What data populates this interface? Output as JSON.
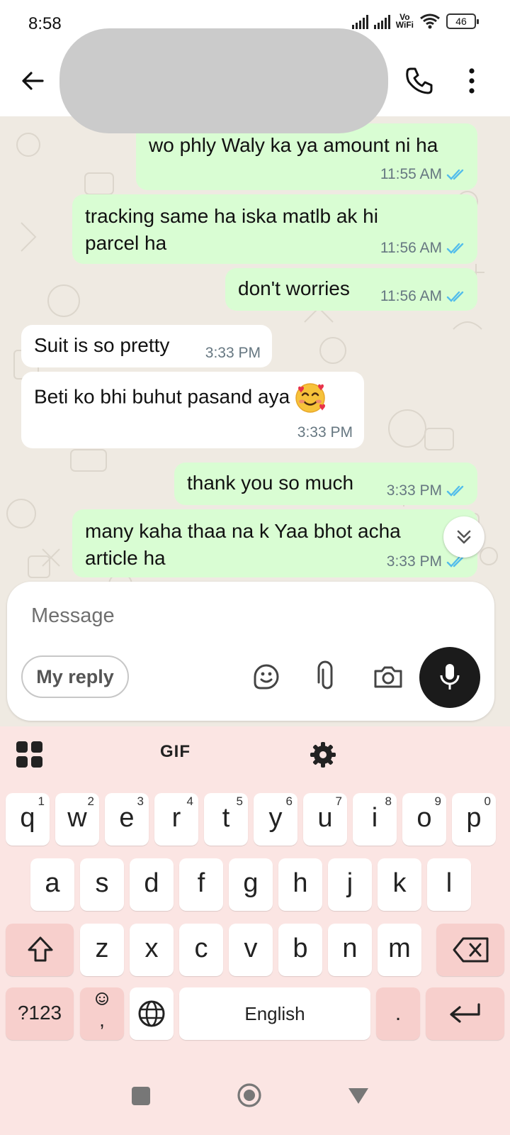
{
  "status_bar": {
    "time": "8:58",
    "network_label_top": "Vo",
    "network_label_bottom": "WiFi",
    "battery": "46"
  },
  "header": {
    "back_icon": "arrow-left-icon",
    "call_icon": "phone-icon",
    "menu_icon": "more-vertical-icon"
  },
  "messages": [
    {
      "direction": "outgoing",
      "text": "wo phly Waly ka ya amount ni ha",
      "time": "11:55 AM",
      "read": true
    },
    {
      "direction": "outgoing",
      "text": "tracking same ha iska matlb ak hi parcel ha",
      "time": "11:56 AM",
      "read": true
    },
    {
      "direction": "outgoing",
      "text": "don't worries",
      "time": "11:56 AM",
      "read": true
    },
    {
      "direction": "incoming",
      "text": "Suit is so pretty",
      "time": "3:33 PM"
    },
    {
      "direction": "incoming",
      "text": "Beti ko bhi buhut pasand aya",
      "emoji": "smiling-face-with-hearts",
      "time": "3:33 PM"
    },
    {
      "direction": "outgoing",
      "text": "thank you so much",
      "time": "3:33 PM",
      "read": true
    },
    {
      "direction": "outgoing",
      "text": "many kaha thaa na k Yaa bhot acha article ha",
      "time": "3:33 PM",
      "read": true
    }
  ],
  "composer": {
    "placeholder": "Message",
    "reply_chip": "My reply",
    "icons": [
      "sticker-icon",
      "attachment-icon",
      "camera-icon",
      "microphone-icon"
    ]
  },
  "keyboard": {
    "toolbar": {
      "gif_label": "GIF",
      "icons": [
        "apps-grid-icon",
        "settings-gear-icon"
      ]
    },
    "row1": [
      {
        "key": "q",
        "hint": "1"
      },
      {
        "key": "w",
        "hint": "2"
      },
      {
        "key": "e",
        "hint": "3"
      },
      {
        "key": "r",
        "hint": "4"
      },
      {
        "key": "t",
        "hint": "5"
      },
      {
        "key": "y",
        "hint": "6"
      },
      {
        "key": "u",
        "hint": "7"
      },
      {
        "key": "i",
        "hint": "8"
      },
      {
        "key": "o",
        "hint": "9"
      },
      {
        "key": "p",
        "hint": "0"
      }
    ],
    "row2": [
      "a",
      "s",
      "d",
      "f",
      "g",
      "h",
      "j",
      "k",
      "l"
    ],
    "row3": [
      "z",
      "x",
      "c",
      "v",
      "b",
      "n",
      "m"
    ],
    "symbols_key": "?123",
    "emoji_comma_key": ",",
    "space_label": "English",
    "period_key": "."
  },
  "colors": {
    "outgoing_bubble": "#d9fdd3",
    "incoming_bubble": "#ffffff",
    "chat_background": "#efeae2",
    "read_tick": "#53bdeb",
    "keyboard_background": "#fbe5e3",
    "function_key": "#f7cfcc"
  }
}
